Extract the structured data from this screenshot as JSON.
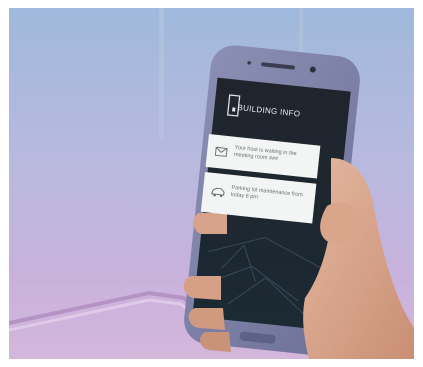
{
  "phone": {
    "app_title": "BUILDING INFO",
    "notifications": [
      {
        "icon": "envelope-icon",
        "text": "Your host is waiting in the meeting room ###"
      },
      {
        "icon": "car-icon",
        "text": "Parking lot maintenance from today 6 pm"
      }
    ]
  },
  "colors": {
    "background_top": "#9fb9dc",
    "background_bottom": "#d4b6db",
    "phone_body": "#7f82a8",
    "screen": "#1c2530",
    "card": "#f3f4f4",
    "skin": "#d8a78e"
  }
}
